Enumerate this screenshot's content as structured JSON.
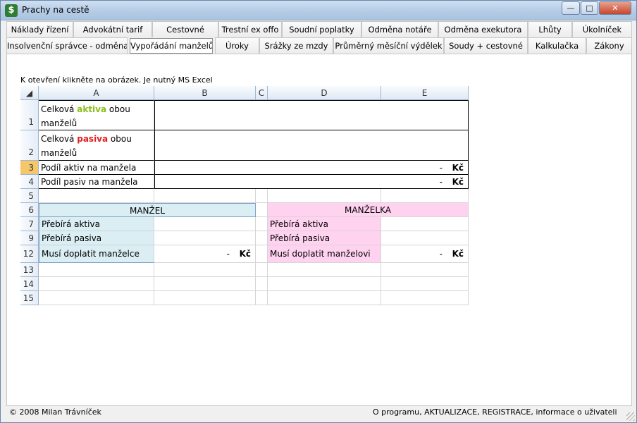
{
  "window": {
    "title": "Prachy na cestě",
    "icon": "dollar-icon"
  },
  "tabs_row1": [
    "Náklady řízení",
    "Advokátní tarif",
    "Cestovné",
    "Trestní ex offo",
    "Soudní poplatky",
    "Odměna notáře",
    "Odměna exekutora",
    "Lhůty",
    "Úkolníček"
  ],
  "tabs_row2": [
    "Insolvenční správce - odměna",
    "Vypořádání manželů",
    "Úroky",
    "Srážky ze mzdy",
    "Průměrný měsíční výdělek",
    "Soudy + cestovné",
    "Kalkulačka",
    "Zákony"
  ],
  "active_tab": "Vypořádání manželů",
  "hint": "K otevření klikněte na obrázek. Je nutný MS Excel",
  "sheet": {
    "columns": [
      "A",
      "B",
      "C",
      "D",
      "E"
    ],
    "rows": {
      "r1_label_pre": "Celková ",
      "r1_label_word": "aktiva",
      "r1_label_post": " obou manželů",
      "r2_label_pre": "Celková ",
      "r2_label_word": "pasiva",
      "r2_label_post": " obou manželů",
      "r3_label": "Podíl aktiv na manžela",
      "r4_label": "Podíl pasiv na manžela",
      "dash": "-",
      "currency": "Kč",
      "manzel_header": "MANŽEL",
      "manzelka_header": "MANŽELKA",
      "prebira_aktiva": "Přebírá aktiva",
      "prebira_pasiva": "Přebírá pasiva",
      "musi_manzelce": "Musí doplatit manželce",
      "musi_manzelovi": "Musí doplatit manželovi"
    },
    "row_numbers": [
      "1",
      "2",
      "3",
      "4",
      "5",
      "6",
      "7",
      "9",
      "12",
      "13",
      "14",
      "15"
    ]
  },
  "footer": {
    "copyright": "© 2008 Milan Trávníček",
    "links": "O programu, AKTUALIZACE, REGISTRACE, informace o uživateli"
  },
  "colors": {
    "accent_green": "#8ac01a",
    "accent_red": "#e02020",
    "blue_fill": "#daeef3",
    "pink_fill": "#ffd3f0",
    "selected_row": "#f5c76a"
  }
}
